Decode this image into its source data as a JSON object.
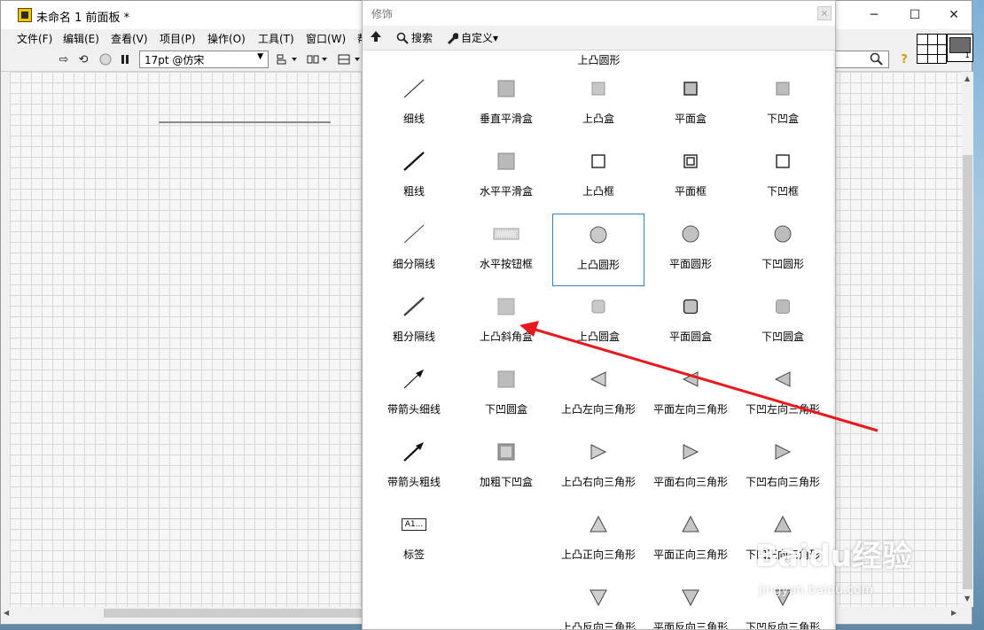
{
  "window": {
    "title": "未命名 1 前面板 *",
    "controls": [
      "─",
      "☐",
      "✕"
    ]
  },
  "menu": [
    "文件(F)",
    "编辑(E)",
    "查看(V)",
    "项目(P)",
    "操作(O)",
    "工具(T)",
    "窗口(W)",
    "帮"
  ],
  "toolbar": {
    "font_value": "17pt @仿宋",
    "help_glyph": "?"
  },
  "vi_icon": {
    "number": "1"
  },
  "palette": {
    "title": "修饰",
    "close_glyph": "×",
    "toolbar": {
      "search_label": "搜索",
      "customize_label": "自定义▾"
    },
    "heading": "上凸圆形",
    "items": [
      {
        "label": "细线",
        "icon": "thin-line-icon"
      },
      {
        "label": "垂直平滑盒",
        "icon": "vertical-smooth-box-icon"
      },
      {
        "label": "上凸盒",
        "icon": "raised-box-icon"
      },
      {
        "label": "平面盒",
        "icon": "flat-box-icon"
      },
      {
        "label": "下凹盒",
        "icon": "recessed-box-icon"
      },
      {
        "label": "粗线",
        "icon": "thick-line-icon"
      },
      {
        "label": "水平平滑盒",
        "icon": "horizontal-smooth-box-icon"
      },
      {
        "label": "上凸框",
        "icon": "raised-frame-icon"
      },
      {
        "label": "平面框",
        "icon": "flat-frame-icon"
      },
      {
        "label": "下凹框",
        "icon": "recessed-frame-icon"
      },
      {
        "label": "细分隔线",
        "icon": "thin-divider-icon"
      },
      {
        "label": "水平按钮框",
        "icon": "horizontal-button-box-icon"
      },
      {
        "label": "上凸圆形",
        "icon": "raised-circle-icon",
        "selected": true
      },
      {
        "label": "平面圆形",
        "icon": "flat-circle-icon"
      },
      {
        "label": "下凹圆形",
        "icon": "recessed-circle-icon"
      },
      {
        "label": "粗分隔线",
        "icon": "thick-divider-icon"
      },
      {
        "label": "上凸斜角盒",
        "icon": "raised-bevel-box-icon"
      },
      {
        "label": "上凸圆盒",
        "icon": "raised-rounded-box-icon"
      },
      {
        "label": "平面圆盒",
        "icon": "flat-rounded-box-icon"
      },
      {
        "label": "下凹圆盒",
        "icon": "recessed-rounded-box-icon"
      },
      {
        "label": "带箭头细线",
        "icon": "thin-arrow-line-icon"
      },
      {
        "label": "下凹圆盒",
        "icon": "recessed-rounded-box-2-icon"
      },
      {
        "label": "上凸左向三角形",
        "icon": "raised-left-triangle-icon"
      },
      {
        "label": "平面左向三角形",
        "icon": "flat-left-triangle-icon"
      },
      {
        "label": "下凹左向三角形",
        "icon": "recessed-left-triangle-icon"
      },
      {
        "label": "带箭头粗线",
        "icon": "thick-arrow-line-icon"
      },
      {
        "label": "加粗下凹盒",
        "icon": "bold-recessed-box-icon"
      },
      {
        "label": "上凸右向三角形",
        "icon": "raised-right-triangle-icon"
      },
      {
        "label": "平面右向三角形",
        "icon": "flat-right-triangle-icon"
      },
      {
        "label": "下凹右向三角形",
        "icon": "recessed-right-triangle-icon"
      },
      {
        "label": "标签",
        "icon": "label-icon",
        "icon_text": "A1..."
      },
      {
        "label": "",
        "icon": ""
      },
      {
        "label": "上凸正向三角形",
        "icon": "raised-up-triangle-icon"
      },
      {
        "label": "平面正向三角形",
        "icon": "flat-up-triangle-icon"
      },
      {
        "label": "下凹正向三角形",
        "icon": "recessed-up-triangle-icon"
      },
      {
        "label": "",
        "icon": ""
      },
      {
        "label": "",
        "icon": ""
      },
      {
        "label": "上凸反向三角形",
        "icon": "raised-down-triangle-icon"
      },
      {
        "label": "平面反向三角形",
        "icon": "flat-down-triangle-icon"
      },
      {
        "label": "下凹反向三角形",
        "icon": "recessed-down-triangle-icon"
      }
    ]
  },
  "watermark": {
    "logo": "Baidu经验",
    "sub": "jingyan.baidu.com"
  },
  "colors": {
    "annotation_arrow": "#e8191c",
    "selection_border": "#3c7fb1"
  }
}
